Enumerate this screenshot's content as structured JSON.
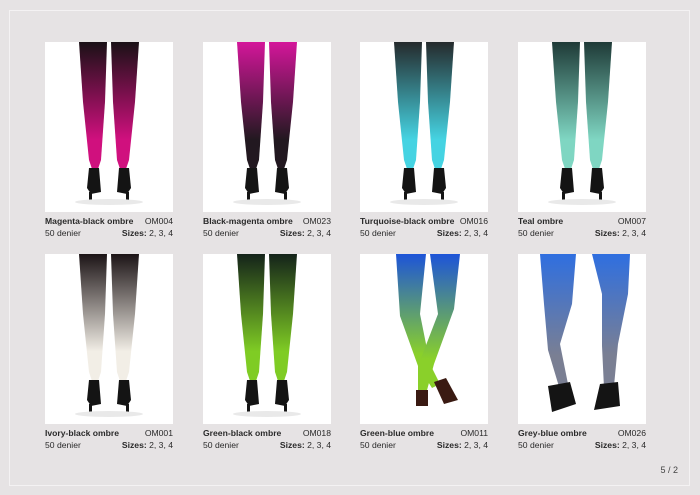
{
  "page": "5 / 2",
  "products": [
    {
      "name": "Magenta-black ombre",
      "code": "OM004",
      "denier": "50 denier",
      "sizes_label": "Sizes:",
      "sizes": "2, 3, 4",
      "top": "#1a1116",
      "bottom": "#d0107e",
      "shoe": "#141414"
    },
    {
      "name": "Black-magenta ombre",
      "code": "OM023",
      "denier": "50 denier",
      "sizes_label": "Sizes:",
      "sizes": "2, 3, 4",
      "top": "#d4169a",
      "bottom": "#221820",
      "shoe": "#141414"
    },
    {
      "name": "Turquoise-black ombre",
      "code": "OM016",
      "denier": "50 denier",
      "sizes_label": "Sizes:",
      "sizes": "2, 3, 4",
      "top": "#252a2c",
      "bottom": "#45d3e2",
      "shoe": "#141414"
    },
    {
      "name": "Teal ombre",
      "code": "OM007",
      "denier": "50 denier",
      "sizes_label": "Sizes:",
      "sizes": "2, 3, 4",
      "top": "#1f3a37",
      "bottom": "#7fd6c2",
      "shoe": "#141414"
    },
    {
      "name": "Ivory-black ombre",
      "code": "OM001",
      "denier": "50 denier",
      "sizes_label": "Sizes:",
      "sizes": "2, 3, 4",
      "top": "#1c1416",
      "bottom": "#f2eee6",
      "shoe": "#141414"
    },
    {
      "name": "Green-black ombre",
      "code": "OM018",
      "denier": "50 denier",
      "sizes_label": "Sizes:",
      "sizes": "2, 3, 4",
      "top": "#14231a",
      "bottom": "#7fcc24",
      "shoe": "#141414"
    },
    {
      "name": "Green-blue ombre",
      "code": "OM011",
      "denier": "50 denier",
      "sizes_label": "Sizes:",
      "sizes": "2, 3, 4",
      "top": "#1d54d8",
      "bottom": "#8ad02a",
      "shoe": "#3a1a12"
    },
    {
      "name": "Grey-blue ombre",
      "code": "OM026",
      "denier": "50 denier",
      "sizes_label": "Sizes:",
      "sizes": "2, 3, 4",
      "top": "#2f6fe0",
      "bottom": "#7a7f93",
      "shoe": "#141414"
    }
  ]
}
